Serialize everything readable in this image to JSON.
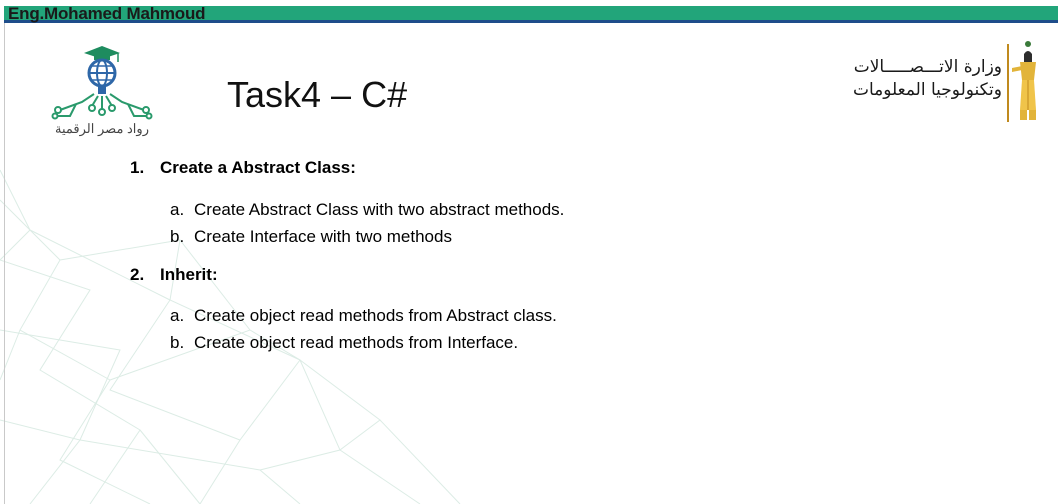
{
  "header": {
    "author": "Eng.Mohamed Mahmoud",
    "accent_green": "#22a57a",
    "accent_blue": "#1e4d8a"
  },
  "logo_left": {
    "caption": "رواد مصر الرقمية",
    "icon": "graduation-globe-icon"
  },
  "logo_right": {
    "line1": "وزارة الاتـــصـــــالات",
    "line2": "وتكنولوجيا المعلومات",
    "icon": "pharaonic-figure-icon"
  },
  "title": "Task4 – C#",
  "items": [
    {
      "number": "1.",
      "label": "Create a Abstract Class:",
      "subs": [
        {
          "letter": "a.",
          "text": "Create Abstract Class with two abstract methods."
        },
        {
          "letter": "b.",
          "text": "Create Interface with two methods"
        }
      ]
    },
    {
      "number": "2.",
      "label": "Inherit:",
      "subs": [
        {
          "letter": "a.",
          "text": "Create object read methods from Abstract class."
        },
        {
          "letter": "b.",
          "text": "Create object read methods from Interface."
        }
      ]
    }
  ]
}
